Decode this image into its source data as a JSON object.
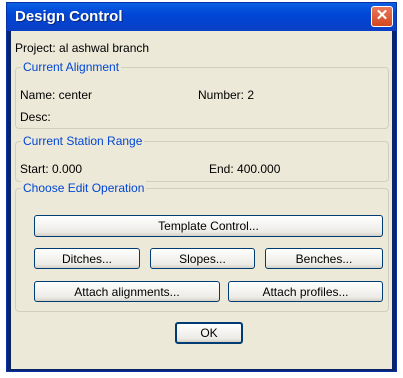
{
  "window": {
    "title": "Design Control",
    "close_glyph": "✕"
  },
  "project": {
    "text": "Project: al ashwal branch"
  },
  "alignment": {
    "legend": "Current Alignment",
    "name": "Name: center",
    "number": "Number: 2",
    "desc": "Desc:"
  },
  "station": {
    "legend": "Current Station Range",
    "start": "Start: 0.000",
    "end": "End: 400.000"
  },
  "edit": {
    "legend": "Choose Edit Operation",
    "template_control": "Template Control...",
    "ditches": "Ditches...",
    "slopes": "Slopes...",
    "benches": "Benches...",
    "attach_alignments": "Attach alignments...",
    "attach_profiles": "Attach profiles..."
  },
  "ok": "OK",
  "colors": {
    "titlebar": "#0054e3",
    "group_label": "#0046d5",
    "client_bg": "#ece9d8"
  },
  "icons": {
    "close": "close-icon"
  }
}
